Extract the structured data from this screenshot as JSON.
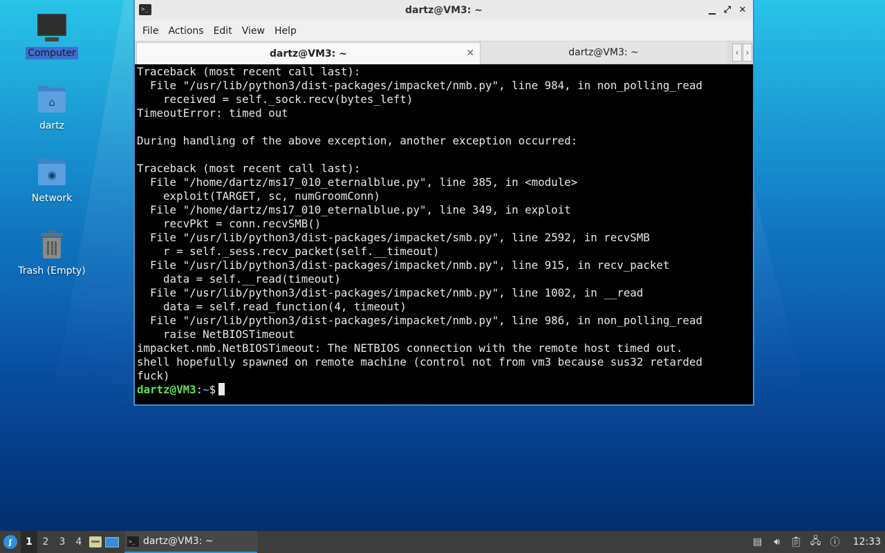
{
  "desktop": {
    "icons": [
      {
        "label": "Computer",
        "icon": "computer-icon",
        "selected": true
      },
      {
        "label": "dartz",
        "icon": "home-folder-icon"
      },
      {
        "label": "Network",
        "icon": "network-folder-icon"
      },
      {
        "label": "Trash (Empty)",
        "icon": "trash-icon"
      }
    ]
  },
  "window": {
    "title": "dartz@VM3: ~",
    "buttons": {
      "minimize": "▁",
      "maximize": "⤢",
      "close": "✕"
    },
    "menu": [
      "File",
      "Actions",
      "Edit",
      "View",
      "Help"
    ],
    "tabs": [
      {
        "label": "dartz@VM3: ~",
        "active": true
      },
      {
        "label": "dartz@VM3: ~",
        "active": false
      }
    ],
    "tab_close": "✕",
    "tab_scroll_left": "‹",
    "tab_scroll_right": "›"
  },
  "terminal": {
    "output": "Traceback (most recent call last):\n  File \"/usr/lib/python3/dist-packages/impacket/nmb.py\", line 984, in non_polling_read\n    received = self._sock.recv(bytes_left)\nTimeoutError: timed out\n\nDuring handling of the above exception, another exception occurred:\n\nTraceback (most recent call last):\n  File \"/home/dartz/ms17_010_eternalblue.py\", line 385, in <module>\n    exploit(TARGET, sc, numGroomConn)\n  File \"/home/dartz/ms17_010_eternalblue.py\", line 349, in exploit\n    recvPkt = conn.recvSMB()\n  File \"/usr/lib/python3/dist-packages/impacket/smb.py\", line 2592, in recvSMB\n    r = self._sess.recv_packet(self.__timeout)\n  File \"/usr/lib/python3/dist-packages/impacket/nmb.py\", line 915, in recv_packet\n    data = self.__read(timeout)\n  File \"/usr/lib/python3/dist-packages/impacket/nmb.py\", line 1002, in __read\n    data = self.read_function(4, timeout)\n  File \"/usr/lib/python3/dist-packages/impacket/nmb.py\", line 986, in non_polling_read\n    raise NetBIOSTimeout\nimpacket.nmb.NetBIOSTimeout: The NETBIOS connection with the remote host timed out.\nshell hopefully spawned on remote machine (control not from vm3 because sus32 retarded\nfuck)",
    "prompt_user": "dartz@VM3",
    "prompt_sep": ":",
    "prompt_path": "~",
    "prompt_symbol": "$"
  },
  "taskbar": {
    "start_icon": "lubuntu-start-icon",
    "workspaces": [
      "1",
      "2",
      "3",
      "4"
    ],
    "active_workspace": "1",
    "launchers": [
      "file-manager-icon",
      "show-desktop-icon"
    ],
    "task_label": "dartz@VM3: ~",
    "tray": [
      "updates-icon",
      "volume-icon",
      "clipboard-icon",
      "network-icon",
      "notification-icon"
    ],
    "clock": "12:33"
  },
  "colors": {
    "accent": "#3b8fd6",
    "prompt_user": "#56e356",
    "prompt_path": "#5b8cff",
    "taskbar": "#3d3d3d"
  }
}
